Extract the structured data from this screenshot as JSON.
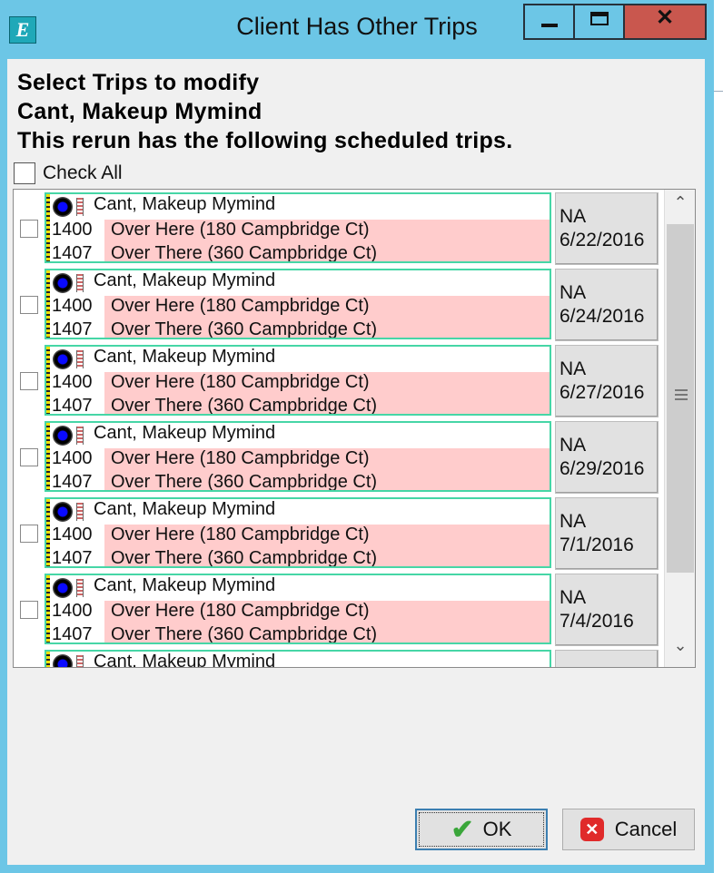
{
  "window": {
    "title": "Client Has Other Trips",
    "icon_letter": "E",
    "controls": {
      "minimize": "minimize",
      "maximize": "maximize",
      "close": "close"
    }
  },
  "headers": {
    "line1": "Select Trips to modify",
    "line2": "Cant, Makeup Mymind",
    "line3": "This rerun has the following scheduled trips."
  },
  "check_all": {
    "label": "Check All",
    "checked": false
  },
  "trips": [
    {
      "name": "Cant, Makeup Mymind",
      "pickup_time": "1400",
      "pickup_loc": "Over Here (180 Campbridge Ct)",
      "drop_time": "1407",
      "drop_loc": "Over There (360 Campbridge Ct)",
      "status": "NA",
      "date": "6/22/2016"
    },
    {
      "name": "Cant, Makeup Mymind",
      "pickup_time": "1400",
      "pickup_loc": "Over Here (180 Campbridge Ct)",
      "drop_time": "1407",
      "drop_loc": "Over There (360 Campbridge Ct)",
      "status": "NA",
      "date": "6/24/2016"
    },
    {
      "name": "Cant, Makeup Mymind",
      "pickup_time": "1400",
      "pickup_loc": "Over Here (180 Campbridge Ct)",
      "drop_time": "1407",
      "drop_loc": "Over There (360 Campbridge Ct)",
      "status": "NA",
      "date": "6/27/2016"
    },
    {
      "name": "Cant, Makeup Mymind",
      "pickup_time": "1400",
      "pickup_loc": "Over Here (180 Campbridge Ct)",
      "drop_time": "1407",
      "drop_loc": "Over There (360 Campbridge Ct)",
      "status": "NA",
      "date": "6/29/2016"
    },
    {
      "name": "Cant, Makeup Mymind",
      "pickup_time": "1400",
      "pickup_loc": "Over Here (180 Campbridge Ct)",
      "drop_time": "1407",
      "drop_loc": "Over There (360 Campbridge Ct)",
      "status": "NA",
      "date": "7/1/2016"
    },
    {
      "name": "Cant, Makeup Mymind",
      "pickup_time": "1400",
      "pickup_loc": "Over Here (180 Campbridge Ct)",
      "drop_time": "1407",
      "drop_loc": "Over There (360 Campbridge Ct)",
      "status": "NA",
      "date": "7/4/2016"
    },
    {
      "name": "Cant, Makeup Mymind",
      "pickup_time": "",
      "pickup_loc": "",
      "drop_time": "",
      "drop_loc": "",
      "status": "",
      "date": ""
    }
  ],
  "scrollbar": {
    "up": "⌃",
    "down": "⌄"
  },
  "buttons": {
    "ok": "OK",
    "cancel": "Cancel"
  },
  "colors": {
    "titlebar": "#6cc6e6",
    "close_button": "#c9574e",
    "card_border": "#46d6a6",
    "location_bg": "#ffcccc"
  },
  "icons": [
    "app-logo-icon",
    "minimize-icon",
    "maximize-icon",
    "close-icon",
    "client-type-icon",
    "status-flag-icon",
    "scroll-up-icon",
    "scroll-down-icon",
    "checkmark-icon",
    "cancel-x-icon"
  ]
}
